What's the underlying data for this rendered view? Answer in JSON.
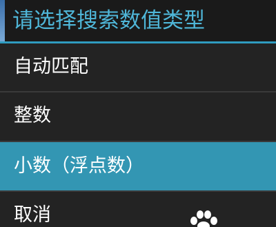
{
  "dialog": {
    "title": "请选择搜索数值类型",
    "options": [
      {
        "label": "自动匹配",
        "selected": false
      },
      {
        "label": "整数",
        "selected": false
      },
      {
        "label": "小数（浮点数）",
        "selected": true
      },
      {
        "label": "取消",
        "selected": false
      }
    ]
  },
  "colors": {
    "title_text": "#4fb6d8",
    "accent_divider": "#2f9cc0",
    "selected_background": "#3396b3",
    "background": "#232323"
  },
  "watermark_icon": "paw-icon"
}
